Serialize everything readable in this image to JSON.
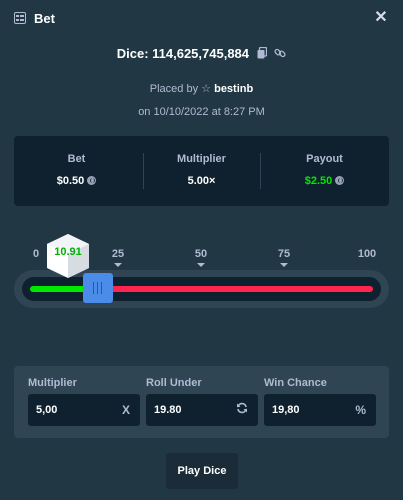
{
  "header": {
    "title": "Bet",
    "title_icon": "bet-list-icon",
    "close_icon": "close-icon"
  },
  "bet": {
    "title": "Dice: 114,625,745,884",
    "placed_prefix": "Placed by",
    "user": "bestinb",
    "date": "on 10/10/2022 at 8:27 PM"
  },
  "stats": {
    "bet_label": "Bet",
    "bet_value": "$0.50",
    "multiplier_label": "Multiplier",
    "multiplier_value": "5.00×",
    "payout_label": "Payout",
    "payout_value": "$2.50"
  },
  "slider": {
    "ticks": [
      "0",
      "25",
      "50",
      "75",
      "100"
    ],
    "result": "10.91",
    "roll_under": 19.8
  },
  "controls": {
    "multiplier_label": "Multiplier",
    "multiplier_value": "5,00",
    "multiplier_suffix": "X",
    "roll_under_label": "Roll Under",
    "roll_under_value": "19.80",
    "win_chance_label": "Win Chance",
    "win_chance_value": "19,80",
    "win_chance_suffix": "%"
  },
  "play_button": "Play Dice",
  "colors": {
    "background": "#213743",
    "panel": "#0f212e",
    "win": "#00e701",
    "lose": "#ff254e",
    "handle": "#4b8ce8"
  }
}
